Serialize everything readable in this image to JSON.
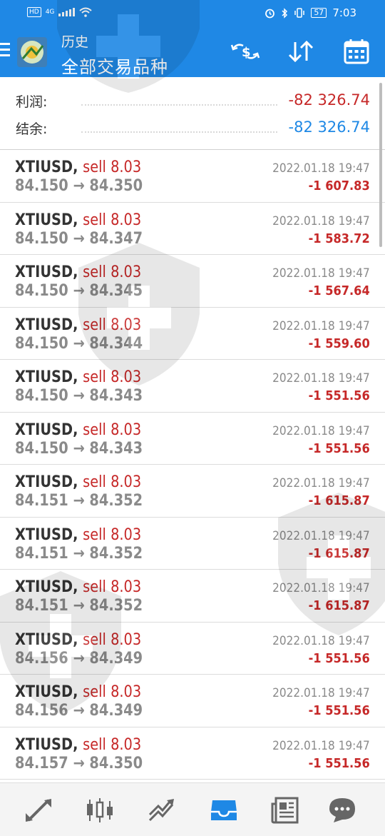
{
  "status_bar": {
    "hd": "HD",
    "net": "4G",
    "battery": "57",
    "time": "7:03"
  },
  "header": {
    "title": "历史",
    "subtitle": "全部交易品种",
    "icons": [
      "menu-icon",
      "currency-swap-icon",
      "sort-icon",
      "calendar-icon"
    ],
    "accent_color": "#1f88e5"
  },
  "summary": {
    "profit_label": "利润:",
    "profit_value": "-82 326.74",
    "balance_label": "结余:",
    "balance_value": "-82 326.74",
    "profit_color": "#c62828",
    "balance_color": "#1e88e5"
  },
  "trades": [
    {
      "symbol": "XTIUSD,",
      "side": "sell 8.03",
      "prices": "84.150 → 84.350",
      "time": "2022.01.18 19:47",
      "profit": "-1 607.83"
    },
    {
      "symbol": "XTIUSD,",
      "side": "sell 8.03",
      "prices": "84.150 → 84.347",
      "time": "2022.01.18 19:47",
      "profit": "-1 583.72"
    },
    {
      "symbol": "XTIUSD,",
      "side": "sell 8.03",
      "prices": "84.150 → 84.345",
      "time": "2022.01.18 19:47",
      "profit": "-1 567.64"
    },
    {
      "symbol": "XTIUSD,",
      "side": "sell 8.03",
      "prices": "84.150 → 84.344",
      "time": "2022.01.18 19:47",
      "profit": "-1 559.60"
    },
    {
      "symbol": "XTIUSD,",
      "side": "sell 8.03",
      "prices": "84.150 → 84.343",
      "time": "2022.01.18 19:47",
      "profit": "-1 551.56"
    },
    {
      "symbol": "XTIUSD,",
      "side": "sell 8.03",
      "prices": "84.150 → 84.343",
      "time": "2022.01.18 19:47",
      "profit": "-1 551.56"
    },
    {
      "symbol": "XTIUSD,",
      "side": "sell 8.03",
      "prices": "84.151 → 84.352",
      "time": "2022.01.18 19:47",
      "profit": "-1 615.87"
    },
    {
      "symbol": "XTIUSD,",
      "side": "sell 8.03",
      "prices": "84.151 → 84.352",
      "time": "2022.01.18 19:47",
      "profit": "-1 615.87"
    },
    {
      "symbol": "XTIUSD,",
      "side": "sell 8.03",
      "prices": "84.151 → 84.352",
      "time": "2022.01.18 19:47",
      "profit": "-1 615.87"
    },
    {
      "symbol": "XTIUSD,",
      "side": "sell 8.03",
      "prices": "84.156 → 84.349",
      "time": "2022.01.18 19:47",
      "profit": "-1 551.56"
    },
    {
      "symbol": "XTIUSD,",
      "side": "sell 8.03",
      "prices": "84.156 → 84.349",
      "time": "2022.01.18 19:47",
      "profit": "-1 551.56"
    },
    {
      "symbol": "XTIUSD,",
      "side": "sell 8.03",
      "prices": "84.157 → 84.350",
      "time": "2022.01.18 19:47",
      "profit": "-1 551.56"
    }
  ],
  "bottom_nav": {
    "items": [
      "quotes-icon",
      "chart-icon",
      "trade-icon",
      "history-icon",
      "news-icon",
      "chat-icon"
    ],
    "active": "history-icon",
    "active_color": "#1e88e5",
    "inactive_color": "#666666"
  }
}
